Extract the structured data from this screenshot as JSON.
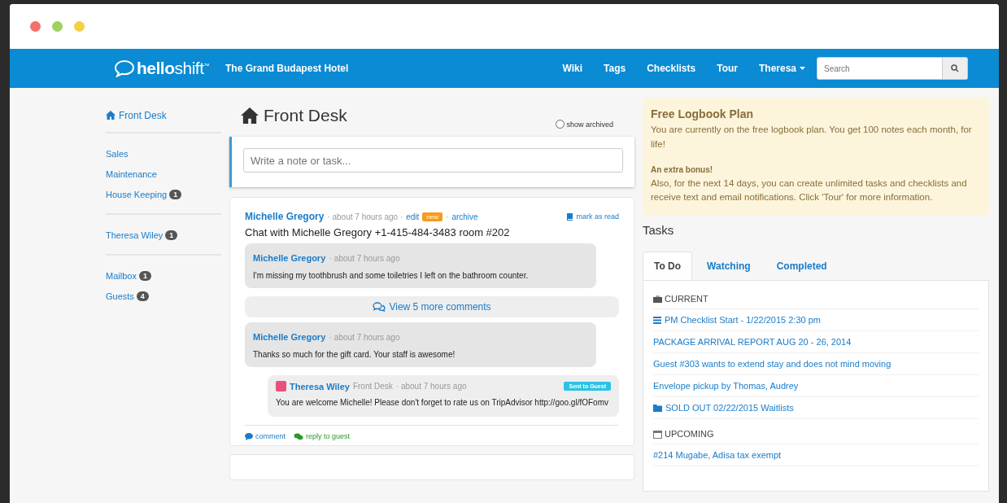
{
  "navbar": {
    "logo": "**hello**shift$^{™}$",
    "hotel": "The Grand Budapest Hotel",
    "links": [
      "Wiki",
      "Tags",
      "Checklists",
      "Tour"
    ],
    "user_menu": "Theresa",
    "search": {
      "placeholder": "Search"
    }
  },
  "sidebar": {
    "header": {
      "label": "Front Desk"
    },
    "groups": [
      {
        "items": [
          {
            "label": "Sales"
          },
          {
            "label": "Maintenance"
          },
          {
            "label": "House Keeping",
            "count": "1"
          }
        ]
      },
      {
        "items": [
          {
            "label": "Theresa Wiley",
            "count": "1"
          }
        ]
      },
      {
        "items": [
          {
            "label": "Mailbox",
            "count": "1"
          },
          {
            "label": "Guests",
            "count": "4"
          }
        ]
      }
    ]
  },
  "page": {
    "title": "Front Desk",
    "show_archived": {
      "label": "show archived",
      "checked": false
    },
    "composer": {
      "placeholder": "Write a note or task..."
    }
  },
  "feed": [
    {
      "author": "Michelle Gregory",
      "time": "· about 7 hours ago ·",
      "edit": "edit",
      "badge": "new",
      "separator": "·",
      "archive": "archive",
      "mark_read": "mark as read",
      "body": "Chat with Michelle Gregory +1-415-484-3483 room #202",
      "thread": [
        {
          "kind": "comment",
          "author": "Michelle Gregory",
          "time": "· about 7 hours ago",
          "body": "I'm missing my toothbrush and some toiletries I left on the bathroom counter."
        },
        {
          "kind": "more",
          "label": "View 5 more comments"
        },
        {
          "kind": "comment",
          "author": "Michelle Gregory",
          "time": "· about 7 hours ago",
          "body": "Thanks so much for the gift card. Your staff is awesome!"
        },
        {
          "kind": "reply",
          "author": "Theresa Wiley",
          "department": "Front Desk",
          "time": "· about 7 hours ago",
          "badge": "Sent to Guest",
          "body": "You are welcome Michelle! Please don't forget to rate us on TripAdvisor http://goo.gl/fOFomv"
        }
      ],
      "actions": [
        {
          "kind": "comment",
          "label": "comment"
        },
        {
          "kind": "reply",
          "label": "reply to guest"
        }
      ]
    }
  ],
  "notice": {
    "title": "Free Logbook Plan",
    "text": "You are currently on the free logbook plan. You get 100 notes each month, for life!",
    "subtitle": "An extra bonus!",
    "text_2": "Also, for the next 14 days, you can create unlimited tasks and checklists and receive text and email notifications. Click 'Tour' for more information."
  },
  "tasks": {
    "title": "Tasks",
    "tabs": [
      {
        "label": "To Do",
        "selected": true
      },
      {
        "label": "Watching",
        "selected": false
      },
      {
        "label": "Completed",
        "selected": false
      }
    ],
    "sections": [
      {
        "kind": "briefcase",
        "title": "CURRENT",
        "items": [
          {
            "kind": "list",
            "label": "PM Checklist Start - 1/22/2015 2:30 pm"
          },
          {
            "label": "PACKAGE ARRIVAL REPORT AUG 20 - 26, 2014"
          },
          {
            "label": "Guest #303 wants to extend stay and does not mind moving"
          },
          {
            "label": "Envelope pickup by Thomas, Audrey"
          },
          {
            "kind": "folder",
            "label": "SOLD OUT 02/22/2015 Waitlists"
          }
        ]
      },
      {
        "kind": "calendar",
        "title": "UPCOMING",
        "items": [
          {
            "label": "#214 Mugabe, Adisa tax exempt"
          }
        ]
      }
    ]
  }
}
